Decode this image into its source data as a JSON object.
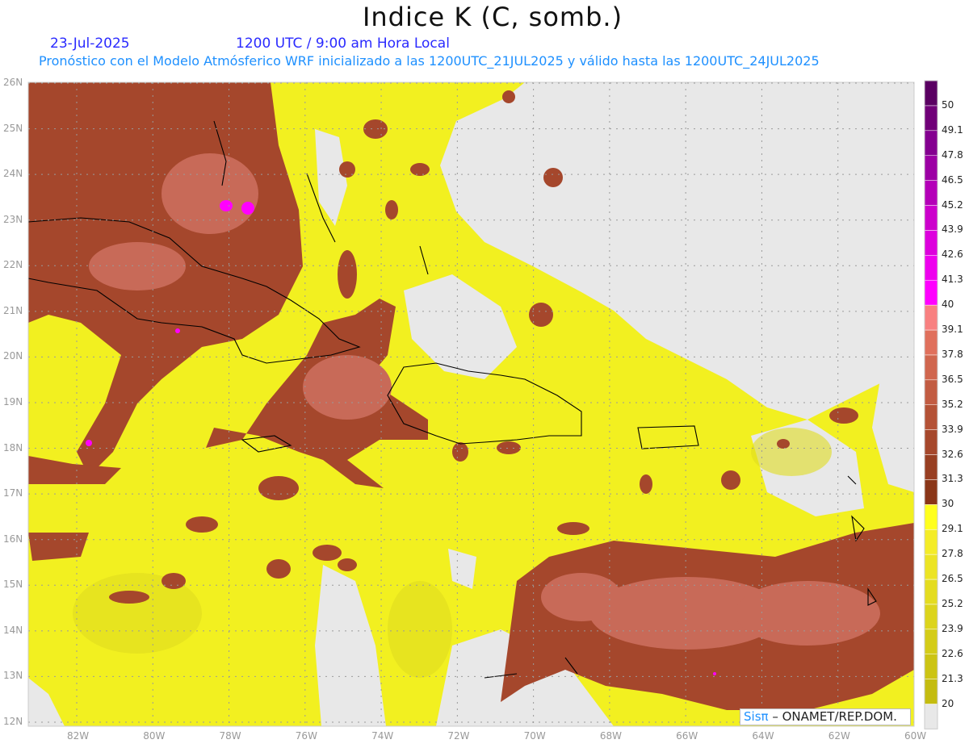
{
  "header": {
    "title": "Indice K (C, somb.)",
    "date": "23-Jul-2025",
    "time": "1200 UTC / 9:00 am Hora Local",
    "subtitle": "Pronóstico con el Modelo Atmósferico WRF inicializado a las 1200UTC_21JUL2025 y válido hasta las  1200UTC_24JUL2025"
  },
  "axes": {
    "lon_labels": [
      "82W",
      "80W",
      "78W",
      "76W",
      "74W",
      "72W",
      "70W",
      "68W",
      "66W",
      "64W",
      "62W",
      "60W"
    ],
    "lat_labels": [
      "26N",
      "25N",
      "24N",
      "23N",
      "22N",
      "21N",
      "20N",
      "19N",
      "18N",
      "17N",
      "16N",
      "15N",
      "14N",
      "13N",
      "12N"
    ]
  },
  "colorbar": {
    "labels": [
      "20",
      "21.3",
      "22.6",
      "23.9",
      "25.2",
      "26.5",
      "27.8",
      "29.1",
      "30",
      "31.3",
      "32.6",
      "33.9",
      "35.2",
      "36.5",
      "37.8",
      "39.1",
      "40",
      "41.3",
      "42.6",
      "43.9",
      "45.2",
      "46.5",
      "47.8",
      "49.1",
      "50"
    ],
    "colors": [
      "#e8e8e8",
      "#c4bc10",
      "#ccc414",
      "#d4cc18",
      "#dcd41c",
      "#e4dc20",
      "#ecE424",
      "#f4ec28",
      "#ffff1e",
      "#8a3618",
      "#983f22",
      "#a6482c",
      "#b45236",
      "#c25c42",
      "#d0664e",
      "#e0705c",
      "#f88080",
      "#ff00ff",
      "#ee00ee",
      "#dd00dd",
      "#cc00cc",
      "#b400b8",
      "#9c00a4",
      "#840090",
      "#700078",
      "#5a0062"
    ]
  },
  "logo": {
    "brand": "Sisπ",
    "org": " – ONAMET/REP.DOM."
  },
  "colors": {
    "no_data": "#e8e8e8",
    "yellow": "#f2f020",
    "brown": "#a5472c",
    "brown_light": "#c86a58",
    "magenta": "#ff00ff",
    "coast": "#000000"
  }
}
